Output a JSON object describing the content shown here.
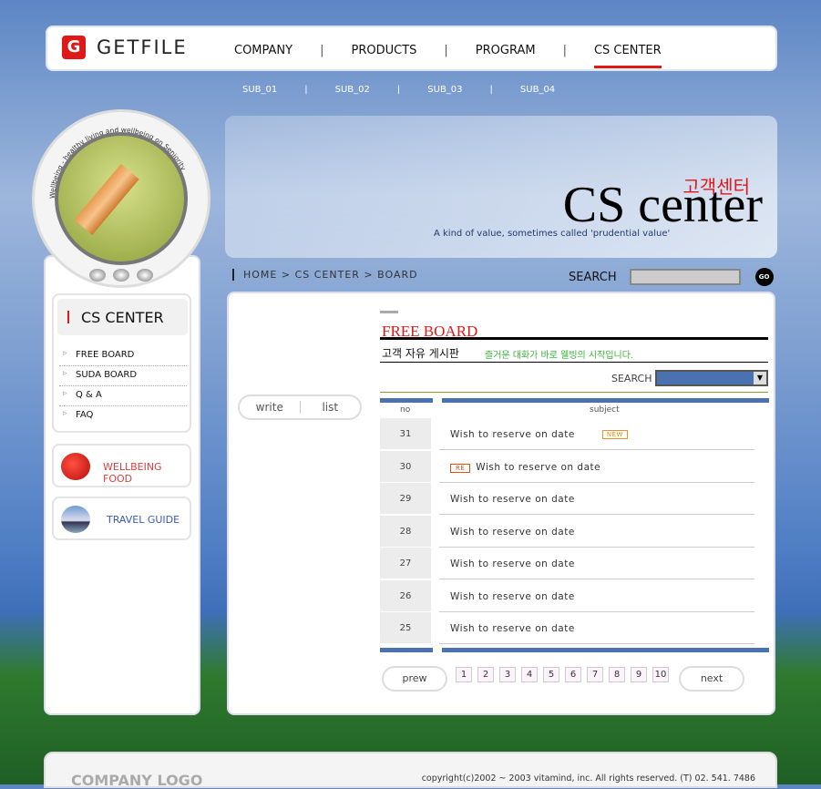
{
  "header": {
    "logo": "GETFILE",
    "nav": [
      "COMPANY",
      "PRODUCTS",
      "PROGRAM",
      "CS CENTER"
    ],
    "active": "CS CENTER",
    "sub": [
      "SUB_01",
      "SUB_02",
      "SUB_03",
      "SUB_04"
    ]
  },
  "badge": {
    "circle_text": "Wellbeing - healthy living and wellbeing on Seniority"
  },
  "sidebar": {
    "title": "CS CENTER",
    "items": [
      "FREE BOARD",
      "SUDA BOARD",
      "Q & A",
      "FAQ"
    ],
    "promo1": "WELLBEING FOOD",
    "promo2": "TRAVEL GUIDE"
  },
  "banner": {
    "title": "CS center",
    "korean": "고객센터",
    "tagline": "A kind of value, sometimes called 'prudential value'"
  },
  "breadcrumb": "HOME > CS CENTER > BOARD",
  "search": {
    "label": "SEARCH",
    "value": "",
    "go": "GO"
  },
  "board": {
    "write": "write",
    "list": "list",
    "title": "FREE BOARD",
    "subtitle": "고객 자유 게시판",
    "desc": "즐거운 대화가 바로 웰빙의 시작입니다.",
    "search_label": "SEARCH",
    "col_no": "no",
    "col_subject": "subject",
    "rows": [
      {
        "no": "31",
        "subject": "Wish to reserve on date",
        "badge": "NEW"
      },
      {
        "no": "30",
        "subject": "Wish to reserve on date",
        "badge": "RE"
      },
      {
        "no": "29",
        "subject": "Wish to reserve on date"
      },
      {
        "no": "28",
        "subject": "Wish to reserve on date"
      },
      {
        "no": "27",
        "subject": "Wish to reserve on date"
      },
      {
        "no": "26",
        "subject": "Wish to reserve on date"
      },
      {
        "no": "25",
        "subject": "Wish to reserve on date"
      }
    ],
    "prev": "prew",
    "next": "next",
    "pages": [
      "1",
      "2",
      "3",
      "4",
      "5",
      "6",
      "7",
      "8",
      "9",
      "10"
    ]
  },
  "footer": {
    "logo": "COMPANY LOGO",
    "copyright": "copyright(c)2002 ~ 2003 vitamind, inc.  All rights reserved. (T) 02. 541. 7486"
  },
  "colors": {
    "accent": "#e01818",
    "blue": "#4a72b0",
    "green": "#3bb33b"
  }
}
